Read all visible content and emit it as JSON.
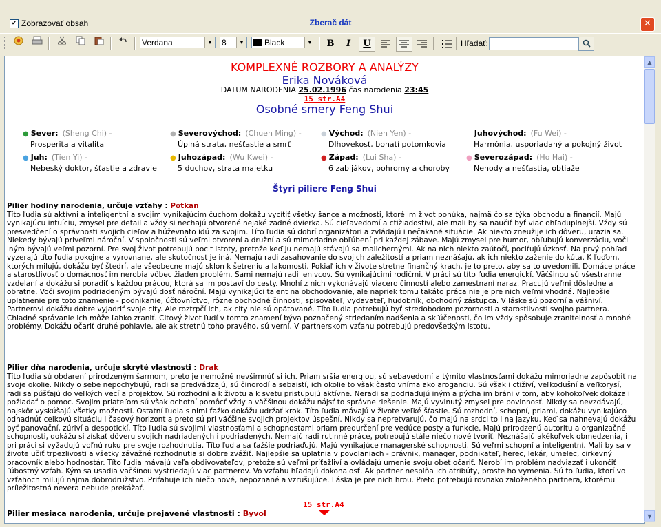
{
  "window": {
    "checkbox_label": "Zobrazovať obsah",
    "checkbox_checked": true,
    "checkbox_mark": "✔",
    "title": "Zberač dát",
    "close_glyph": "✕"
  },
  "toolbar": {
    "font": "Verdana",
    "size": "8",
    "color_name": "Black",
    "color_hex": "#000000",
    "bold": "B",
    "italic": "I",
    "underline": "U",
    "search_label": "Hľadať:",
    "search_value": "",
    "icons": [
      "open-icon",
      "print-icon",
      "cut-icon",
      "copy-icon",
      "paste-icon",
      "undo-icon",
      "align-left-icon",
      "align-center-icon",
      "align-right-icon",
      "list-icon",
      "search-icon"
    ]
  },
  "document": {
    "title": "KOMPLEXNÉ ROZBORY A ANALÝZY",
    "name": "Erika Nováková",
    "birth_label": "DATUM NARODENIA",
    "birth_date": "25.02.1996",
    "birth_time_label": "čas narodenia",
    "birth_time": "23:45",
    "page_ref": "15 str.A4",
    "section_title": "Osobné smery Feng Shui",
    "directions": [
      {
        "name": "Sever:",
        "chinese": "(Sheng Chi) -",
        "desc": "Prosperita a vitalita",
        "color": "#2e9b3a"
      },
      {
        "name": "Severovýchod:",
        "chinese": "(Chueh Ming) -",
        "desc": "Úplná strata, nešťastie a smrť",
        "color": "#b0b0b0"
      },
      {
        "name": "Východ:",
        "chinese": "(Nien Yen) -",
        "desc": "Dlhovekosť, bohatí potomkovia",
        "color": "#c8d0d8"
      },
      {
        "name": "Juhovýchod:",
        "chinese": "(Fu Wei) -",
        "desc": "Harmónia, usporiadaný a pokojný život",
        "color": "#ffffff"
      },
      {
        "name": "Juh:",
        "chinese": "(Tien Yi) -",
        "desc": "Nebeský doktor, šťastie a zdravie",
        "color": "#4aa3e0"
      },
      {
        "name": "Juhozápad:",
        "chinese": "(Wu Kwei) -",
        "desc": "5 duchov, strata majetku",
        "color": "#e8b800"
      },
      {
        "name": "Západ:",
        "chinese": "(Lui Sha) -",
        "desc": "6 zabijákov, pohromy a choroby",
        "color": "#d02020"
      },
      {
        "name": "Severozápad:",
        "chinese": "(Ho Hai) -",
        "desc": "Nehody a nešťastia, obtiaže",
        "color": "#f0a0c0"
      }
    ],
    "pillars_title": "Štyri piliere Feng Shui",
    "pillar_hour": {
      "heading": "Pilier hodiny narodenia, určuje vzťahy : ",
      "animal": "Potkan",
      "text": "Títo ľudia sú aktívni a inteligentní a svojim vynikajúcim čuchom dokážu vycítiť všetky šance a možnosti, ktoré im život ponúka, najmä čo sa týka obchodu a financií. Majú vynikajúcu intuíciu, zmysel pre detail a vždy si nechajú otvorené nejaké zadné dvierka. Sú cieľavedomí a ctižiadostiví, ale mali by sa naučiť byť viac ohľaduplnejší. Vždy sú presvedčení o správnosti svojich cieľov a húževnato idú za svojim. Títo ľudia sú dobrí organizátori a zvládajú i nečakané situácie. Ak niekto zneužije ich dôveru, urazia sa. Niekedy bývajú priveľmi nároční. V spoločnosti sú veľmi otvorení a družní a sú mimoriadne obľúbení pri každej zábave. Majú zmysel pre humor, obľubujú konverzáciu, voči iným bývajú veľmi pozorní. Pre svoj život potrebujú pocit istoty, pretože keď ju nemajú stávajú sa malichernými. Ak na nich niekto zaútočí, pociťujú úzkosť. Na prvý pohľad vyzerajú títo ľudia pokojne a vyrovnane, ale skutočnosť je iná. Nemajú radi zasahovanie do svojich záležitostí a priam neznášajú, ak ich niekto zaženie do kúta. K ľuďom, ktorých milujú, dokážu byť štedrí, ale všeobecne majú sklon k šetreniu a lakomosti. Pokiaľ ich v živote stretne finančný krach, je to preto, aby sa to uvedomili. Domáce práce a starostlivosť o domácnosť im nerobia vôbec žiaden problém. Sami nemajú radi lenivcov. Sú vynikajúcimi rodičmi. V práci sú títo ľudia energickí. Väčšinou sú všestranne vzdelaní a dokážu si poradiť s každou prácou, ktorá sa im postaví do cesty. Mnohí z nich vykonávajú viacero činností alebo zamestnaní naraz. Pracujú veľmi dôsledne a obratne. Voči svojim podriadeným bývajú dosť nároční. Majú vynikajúci talent na obchodovanie, ale napriek tomu takáto práca nie je pre nich veľmi vhodná. Najlepšie uplatnenie pre toto znamenie - podnikanie, účtovníctvo, rôzne obchodné činnosti, spisovateľ, vydavateľ, hudobník, obchodný zástupca. V láske sú pozorní a vášniví. Partnerovi dokážu dobre vyjadriť svoje city. Ale roztrpčí ich, ak city nie sú opätované. Títo ľudia potrebujú byť stredobodom pozornosti a starostlivosti svojho partnera. Chladné správanie ich môže ľahko zraniť. Citový život ľudí v tomto znamení býva poznačený striedaním nadšenia a skľúčenosti, čo im vždy spôsobuje zranitelnosť a mnohé problémy. Dokážu očariť druhé pohlavie, ale ak stretnú toho pravého, sú verní. V partnerskom vzťahu potrebujú predovšetkým istotu."
    },
    "pillar_day": {
      "heading": "Pilier dňa narodenia, určuje skryté vlastnosti : ",
      "animal": "Drak",
      "text": "Títo ľudia sú obdarení prirodzeným šarmom, preto je nemožné nevšimnúť si ich. Priam sršia energiou, sú sebavedomí a týmito vlastnosťami dokážu  mimoriadne zapôsobiť na svoje okolie. Nikdy o sebe nepochybujú, radi sa predvádzajú, sú činorodí a sebaistí, ich okolie to však často vníma ako aroganciu. Sú však i ctiživí, veľkodušní a veľkorysí, radi sa púšťajú do veľkých vecí a projektov. Sú rozhodní a k životu a k svetu pristupujú aktívne. Neradi sa podriaďujú iným a pýcha im bráni v tom, aby kohokoľvek dokázali požiadať o pomoc. Svojim priateľom sú však ochotní pomôcť vždy a väčšinou dokážu nájsť to správne riešenie. Majú vyvinutý zmysel pre  povinnosť. Nikdy sa nevzdávajú, najskôr vyskúšajú všetky možnosti. Ostatní ľudia s nimi ťažko dokážu udržať krok. Títo ľudia mávajú v živote veľké šťastie. Sú rozhodní, schopní, priami, dokážu vynikajúco odhadnúť celkovú situáciu i časový horizont a preto sú pri väčšine svojich projektov úspešní. Nikdy sa nepretvarujú, čo majú na srdci to i na jazyku. Keď sa nahnevajú dokážu byť panovační, zúriví a despotickí. Títo ľudia sú svojimi vlastnosťami a schopnosťami priam predurčení pre vedúce posty a funkcie. Majú prirodzenú autoritu a organizačné schopnosti, dokážu si získať dôveru svojich nadriadených i podriadených. Nemajú radi rutinné práce, potrebujú stále niečo nové tvoriť. Neznášajú akékoľvek obmedzenia, i pri práci si vyžadujú voľnú ruku pre svoje rozhodnutia. Títo ľudia sa ťažšie podriaďujú. Majú vynikajúce managerské schopnosti. Sú veľmi schopní a inteligentní. Mali by sa v živote učiť trpezlivosti a všetky závažné rozhodnutia si dobre zvážiť. Najlepšie sa uplatnia v povolaniach - právnik, manager, podnikateľ, herec, lekár, umelec, cirkevný pracovník alebo hodnostár. Títo ľudia mávajú veľa obdivovateľov, pretože sú veľmi príťažliví a ovládajú umenie svoju obeť očariť. Nerobí im problém nadviazať i ukončiť ľúbostný vzťah. Kým sa usadia väčšinou vystriedajú viac partnerov. Vo vzťahu hľadajú dokonalosť. Ak partner nesplňa ich atribúty, proste ho vymenia. Sú to ľudia, ktorí vo vzťahoch  milujú najmä dobrodružstvo. Priťahuje ich niečo nové, nepoznané a vzrušujúce. Láska je pre nich hrou. Preto potrebujú rovnako založeného partnera, ktorému príležitostná nevera nebude prekážať."
    },
    "pillar_month": {
      "heading": "Pilier mesiaca narodenia, určuje prejavené vlastnosti : ",
      "animal": "Byvol"
    }
  }
}
